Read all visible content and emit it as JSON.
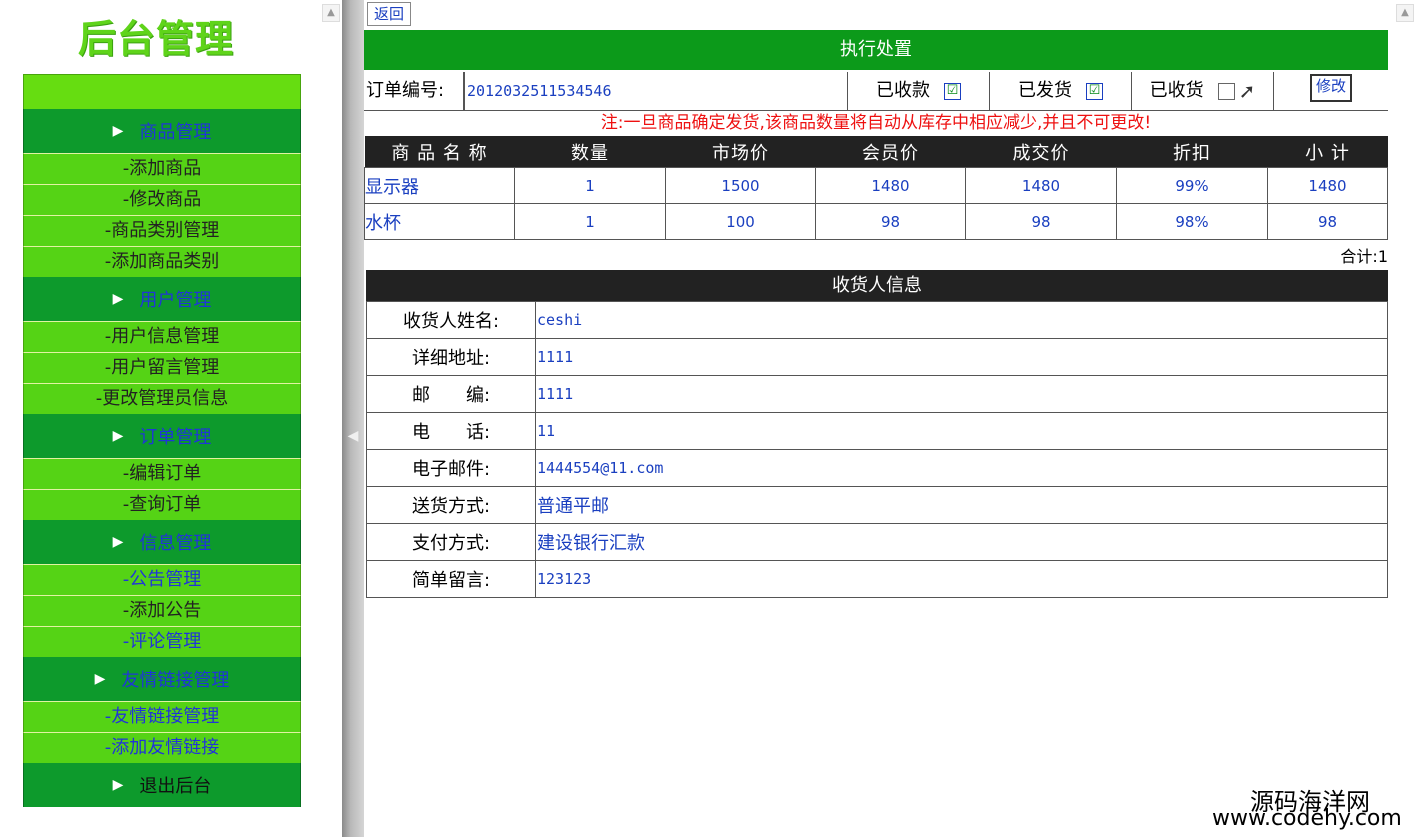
{
  "sidebar": {
    "logo": "后台管理",
    "groups": [
      {
        "title": "商品管理",
        "items": [
          "-添加商品",
          "-修改商品",
          "-商品类别管理",
          "-添加商品类别"
        ]
      },
      {
        "title": "用户管理",
        "items": [
          "-用户信息管理",
          "-用户留言管理",
          "-更改管理员信息"
        ]
      },
      {
        "title": "订单管理",
        "items": [
          "-编辑订单",
          "-查询订单"
        ]
      },
      {
        "title": "信息管理",
        "items": [
          "-公告管理",
          "-添加公告",
          "-评论管理"
        ]
      },
      {
        "title": "友情链接管理",
        "items": [
          "-友情链接管理",
          "-添加友情链接"
        ]
      }
    ],
    "logout": "退出后台"
  },
  "toolbar": {
    "back_label": "返回"
  },
  "exec": {
    "title": "执行处置"
  },
  "order": {
    "number_label": "订单编号:",
    "number": "2012032511534546",
    "paid_label": "已收款",
    "shipped_label": "已发货",
    "received_label": "已收货",
    "paid_checked": "☑",
    "shipped_checked": "☑",
    "modify_label": "修改"
  },
  "notice": "注:一旦商品确定发货,该商品数量将自动从库存中相应减少,并且不可更改!",
  "goods": {
    "headers": [
      "商 品 名 称",
      "数量",
      "市场价",
      "会员价",
      "成交价",
      "折扣",
      "小 计"
    ],
    "rows": [
      [
        "显示器",
        "1",
        "1500",
        "1480",
        "1480",
        "99%",
        "1480"
      ],
      [
        "水杯",
        "1",
        "100",
        "98",
        "98",
        "98%",
        "98"
      ]
    ],
    "total": "合计:1"
  },
  "receiver": {
    "title": "收货人信息",
    "fields": [
      {
        "label": "收货人姓名:",
        "value": "ceshi"
      },
      {
        "label": "详细地址:",
        "value": "1111"
      },
      {
        "label": "邮　　编:",
        "value": "1111"
      },
      {
        "label": "电　　话:",
        "value": "11"
      },
      {
        "label": "电子邮件:",
        "value": "1444554@11.com"
      },
      {
        "label": "送货方式:",
        "value": "普通平邮"
      },
      {
        "label": "支付方式:",
        "value": "建设银行汇款"
      },
      {
        "label": "简单留言:",
        "value": "123123"
      }
    ]
  },
  "watermark": {
    "line1": "源码海洋网",
    "line2": "www.codehy.com"
  }
}
